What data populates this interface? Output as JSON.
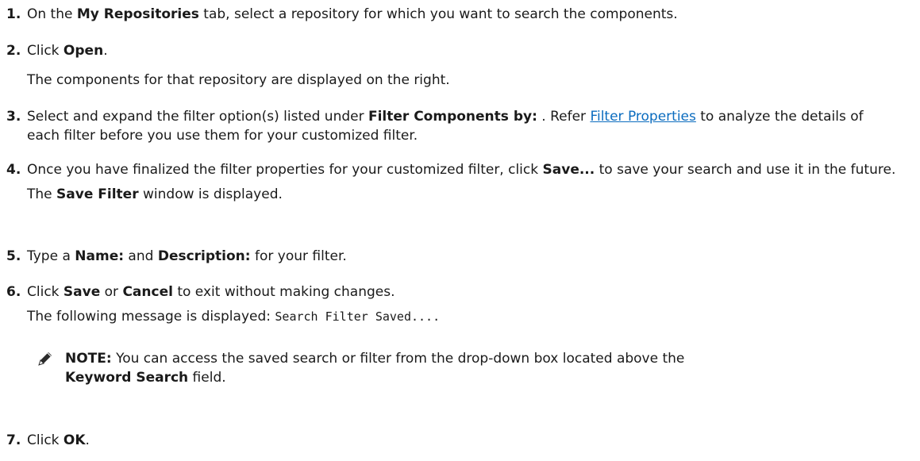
{
  "steps": [
    {
      "num": "1.",
      "pre": "On the ",
      "b1": "My Repositories",
      "post": " tab, select a repository for which you want to search the components."
    },
    {
      "num": "2.",
      "pre": "Click ",
      "b1": "Open",
      "post": ".",
      "sub": "The components for that repository are displayed on the right."
    },
    {
      "num": "3.",
      "pre": "Select and expand the filter option(s) listed under ",
      "b1": "Filter Components by:",
      "mid": " . Refer ",
      "link": "Filter Properties",
      "post": " to analyze the details of each filter before you use them for your customized filter."
    },
    {
      "num": "4.",
      "pre": "Once you have finalized the filter properties for your customized filter, click ",
      "b1": "Save...",
      "post": " to save your search and use it in the future.",
      "sub_pre": "The ",
      "sub_b": "Save Filter",
      "sub_post": " window is displayed."
    },
    {
      "num": "5.",
      "pre": "Type a ",
      "b1": "Name:",
      "mid": " and ",
      "b2": "Description:",
      "post": " for your filter."
    },
    {
      "num": "6.",
      "pre": "Click ",
      "b1": "Save",
      "mid": " or ",
      "b2": "Cancel",
      "post": " to exit without making changes.",
      "sub_pre": "The following message is displayed: ",
      "sub_code": "Search Filter Saved...."
    },
    {
      "num": "7.",
      "pre": "Click ",
      "b1": "OK",
      "post": "."
    }
  ],
  "note": {
    "label": "NOTE:",
    "text": " You can access the saved search or filter from the drop-down box located above the ",
    "b": "Keyword Search",
    "post": " field.",
    "icon": "pencil-icon"
  },
  "colors": {
    "link": "#0b6cbf",
    "text": "#1a1a1a"
  }
}
